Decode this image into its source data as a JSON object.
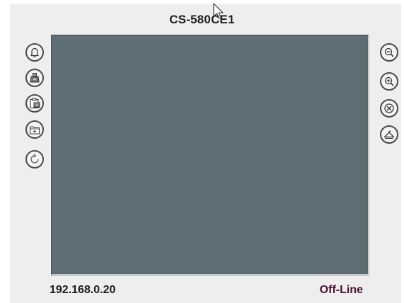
{
  "camera": {
    "title": "CS-580CE1"
  },
  "footer": {
    "ip_address": "192.168.0.20",
    "status": "Off-Line",
    "status_color": "#4a1032"
  },
  "viewport": {
    "background_color": "#5f6e73"
  },
  "left_toolbar": [
    {
      "icon": "bell-icon"
    },
    {
      "icon": "camera-record-icon"
    },
    {
      "icon": "clipboard-snapshot-icon"
    },
    {
      "icon": "folder-icon"
    },
    {
      "icon": "refresh-icon"
    }
  ],
  "right_toolbar": [
    {
      "icon": "zoom-out-icon"
    },
    {
      "icon": "zoom-in-icon"
    },
    {
      "icon": "close-icon"
    },
    {
      "icon": "hanger-icon"
    }
  ]
}
